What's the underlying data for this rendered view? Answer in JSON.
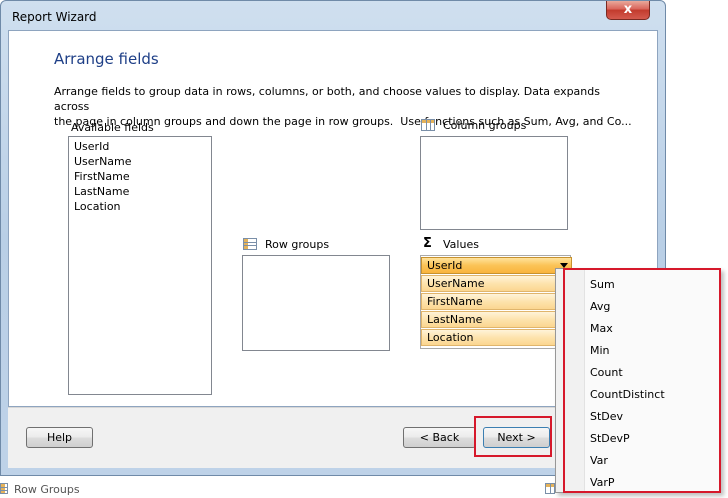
{
  "window": {
    "title": "Report Wizard",
    "close_glyph": "x"
  },
  "page": {
    "heading": "Arrange fields",
    "description": "Arrange fields to group data in rows, columns, or both, and choose values to display. Data expands across\nthe page in column groups and down the page in row groups.  Use functions such as Sum, Avg, and Co..."
  },
  "available_fields": {
    "label": "Available fields",
    "items": [
      "UserId",
      "UserName",
      "FirstName",
      "LastName",
      "Location"
    ]
  },
  "column_groups": {
    "label": "Column groups",
    "icon": "column-groups-icon"
  },
  "row_groups": {
    "label": "Row groups",
    "icon": "row-groups-icon"
  },
  "values": {
    "label": "Values",
    "sigma": "Σ",
    "items": [
      "UserId",
      "UserName",
      "FirstName",
      "LastName",
      "Location"
    ]
  },
  "aggregate_menu": {
    "items": [
      "Sum",
      "Avg",
      "Max",
      "Min",
      "Count",
      "CountDistinct",
      "StDev",
      "StDevP",
      "Var",
      "VarP"
    ]
  },
  "buttons": {
    "help": "Help",
    "back": "< Back",
    "next": "Next >"
  },
  "status_bar": {
    "row_groups": "Row Groups"
  },
  "colors": {
    "heading": "#1e3f87",
    "highlight": "#d6182b",
    "value_pill": "#fbd690"
  }
}
